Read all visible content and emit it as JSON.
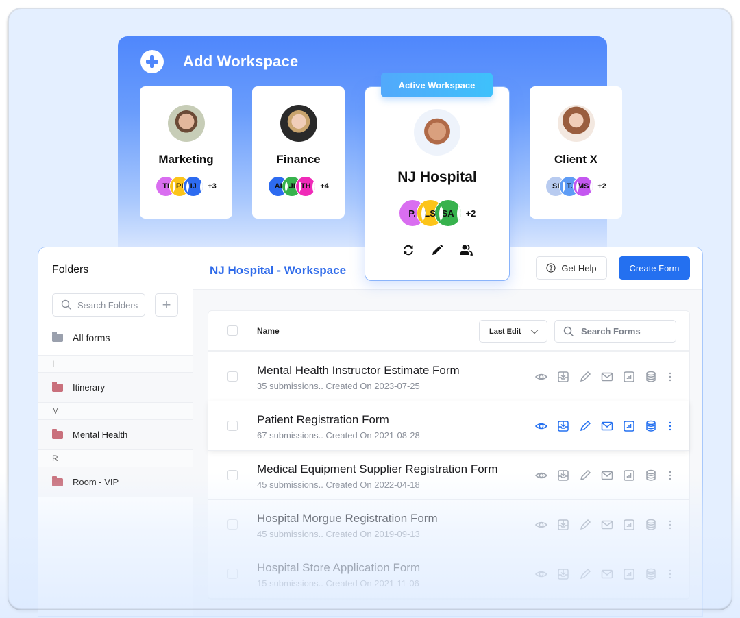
{
  "workspaces": {
    "add_label": "Add Workspace",
    "active_badge": "Active Workspace",
    "cards": [
      {
        "name": "Marketing",
        "members": [
          {
            "initials": "TI",
            "color": "#d96ef0"
          },
          {
            "initials": "PI",
            "color": "#fcc419"
          },
          {
            "initials": "IJ",
            "color": "#2d6bf0"
          }
        ],
        "more": "+3"
      },
      {
        "name": "Finance",
        "members": [
          {
            "initials": "AI",
            "color": "#2d6bf0"
          },
          {
            "initials": "JI",
            "color": "#37b24d"
          },
          {
            "initials": "TH",
            "color": "#f02ab8"
          }
        ],
        "more": "+4"
      },
      {
        "name": "NJ Hospital",
        "members": [
          {
            "initials": "P.",
            "color": "#d96ef0"
          },
          {
            "initials": "LS",
            "color": "#fcc419"
          },
          {
            "initials": "SA",
            "color": "#37b24d"
          }
        ],
        "more": "+2",
        "active": true
      },
      {
        "name": "Client X",
        "members": [
          {
            "initials": "SI",
            "color": "#b8cbf0"
          },
          {
            "initials": "T.",
            "color": "#5e9cf5"
          },
          {
            "initials": "MS",
            "color": "#c457f0"
          }
        ],
        "more": "+2"
      }
    ],
    "active_actions": [
      "sync-icon",
      "edit-pencil-icon",
      "members-icon"
    ]
  },
  "sidebar": {
    "title": "Folders",
    "search_placeholder": "Search Folders",
    "add_label": "+",
    "all_forms": "All forms",
    "groups": [
      {
        "letter": "I",
        "items": [
          "Itinerary"
        ]
      },
      {
        "letter": "M",
        "items": [
          "Mental Health"
        ]
      },
      {
        "letter": "R",
        "items": [
          "Room - VIP"
        ]
      }
    ]
  },
  "main": {
    "title": "NJ Hospital - Workspace",
    "help_label": "Get Help",
    "create_label": "Create Form",
    "table": {
      "name_header": "Name",
      "sort_label": "Last Edit",
      "search_placeholder": "Search Forms",
      "rows": [
        {
          "title": "Mental Health Instructor Estimate Form",
          "meta": "35 submissions.. Created On 2023-07-25"
        },
        {
          "title": "Patient Registration Form",
          "meta": "67 submissions.. Created On 2021-08-28",
          "highlighted": true
        },
        {
          "title": "Medical Equipment Supplier Registration Form",
          "meta": "45 submissions.. Created On 2022-04-18"
        },
        {
          "title": "Hospital Morgue Registration Form",
          "meta": "45 submissions.. Created On 2019-09-13"
        },
        {
          "title": "Hospital Store Application Form",
          "meta": "15 submissions.. Created On 2021-11-06"
        }
      ],
      "row_actions": [
        "view-icon",
        "download-icon",
        "edit-icon",
        "email-icon",
        "report-icon",
        "database-icon",
        "more-icon"
      ]
    }
  },
  "colors": {
    "accent": "#2470f0",
    "action_active": "#2470f0",
    "action_idle": "#9aa0aa",
    "folder": "#c9707c",
    "folder_all": "#9aa0ad"
  }
}
